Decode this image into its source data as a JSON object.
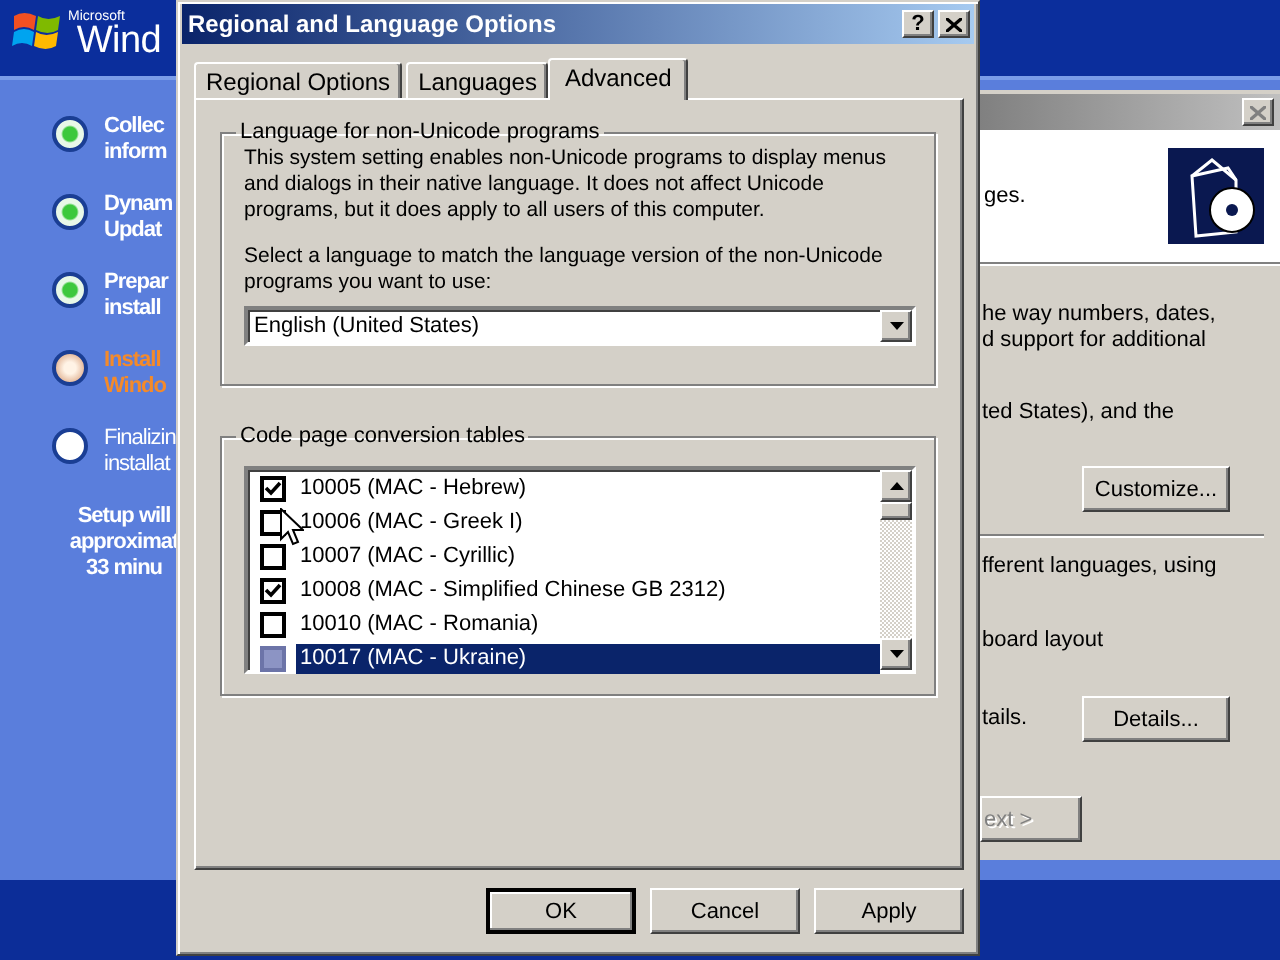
{
  "setup": {
    "logo": {
      "brand": "Microsoft",
      "name": "Wind"
    },
    "steps": [
      {
        "lines": [
          "Collec",
          "inform"
        ],
        "completed": true,
        "current": false
      },
      {
        "lines": [
          "Dynam",
          "Updat"
        ],
        "completed": true,
        "current": false
      },
      {
        "lines": [
          "Prepar",
          "install"
        ],
        "completed": true,
        "current": false
      },
      {
        "lines": [
          "Install",
          "Windo"
        ],
        "completed": false,
        "current": true
      },
      {
        "lines": [
          "Finalizin",
          "installat"
        ],
        "completed": false,
        "current": false
      }
    ],
    "time_estimate": [
      "Setup will",
      "approximat",
      "33 minu"
    ]
  },
  "back_dialog": {
    "header_text": "ges.",
    "formats_text": [
      "he way numbers, dates,",
      "d support for additional"
    ],
    "locale_text": "ted States), and the",
    "customize_button": "Customize...",
    "languages_text": "fferent languages, using",
    "keyboard_text": "board layout",
    "details_text": "tails.",
    "details_button": "Details...",
    "next_button": {
      "label": "ext >",
      "disabled": true
    }
  },
  "main_dialog": {
    "title": "Regional and Language Options",
    "help_button": "?",
    "tabs": [
      {
        "label": "Regional Options",
        "selected": false
      },
      {
        "label": "Languages",
        "selected": false
      },
      {
        "label": "Advanced",
        "selected": true
      }
    ],
    "non_unicode": {
      "title": "Language for non-Unicode programs",
      "description": "This system setting enables non-Unicode programs to display menus and dialogs in their native language. It does not affect Unicode programs, but it does apply to all users of this computer.",
      "prompt": "Select a language to match the language version of the non-Unicode programs you want to use:",
      "language": "English (United States)"
    },
    "code_pages": {
      "title": "Code page conversion tables",
      "items": [
        {
          "label": "10005 (MAC - Hebrew)",
          "checked": true,
          "disabled": false,
          "selected": false
        },
        {
          "label": "10006 (MAC - Greek I)",
          "checked": false,
          "disabled": false,
          "selected": false
        },
        {
          "label": "10007 (MAC - Cyrillic)",
          "checked": false,
          "disabled": false,
          "selected": false
        },
        {
          "label": "10008 (MAC - Simplified Chinese GB 2312)",
          "checked": true,
          "disabled": false,
          "selected": false
        },
        {
          "label": "10010 (MAC - Romania)",
          "checked": false,
          "disabled": false,
          "selected": false
        },
        {
          "label": "10017 (MAC - Ukraine)",
          "checked": false,
          "disabled": true,
          "selected": true
        }
      ]
    },
    "buttons": [
      {
        "label": "OK",
        "default": true
      },
      {
        "label": "Cancel",
        "default": false
      },
      {
        "label": "Apply",
        "default": false
      }
    ]
  }
}
